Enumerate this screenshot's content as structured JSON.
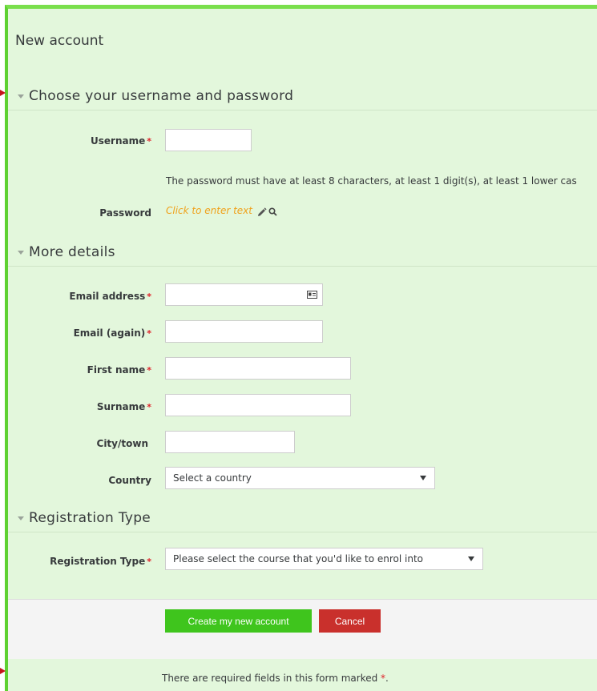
{
  "page": {
    "title": "New account"
  },
  "sections": {
    "credentials": {
      "title": "Choose your username and password"
    },
    "details": {
      "title": "More details"
    },
    "registration": {
      "title": "Registration Type"
    }
  },
  "fields": {
    "username": {
      "label": "Username",
      "value": ""
    },
    "password_hint": "The password must have at least 8 characters, at least 1 digit(s), at least 1 lower cas",
    "password": {
      "label": "Password",
      "link_text": "Click to enter text"
    },
    "email": {
      "label": "Email address",
      "value": ""
    },
    "email_again": {
      "label": "Email (again)",
      "value": ""
    },
    "first_name": {
      "label": "First name",
      "value": ""
    },
    "surname": {
      "label": "Surname",
      "value": ""
    },
    "city": {
      "label": "City/town",
      "value": ""
    },
    "country": {
      "label": "Country",
      "selected": "Select a country"
    },
    "registration_type": {
      "label": "Registration Type",
      "selected": "Please select the course that you'd like to enrol into"
    }
  },
  "required_marker": "*",
  "buttons": {
    "submit": "Create my new account",
    "cancel": "Cancel"
  },
  "footer": {
    "required_note": "There are required fields in this form marked",
    "required_marker": "*",
    "period": "."
  },
  "icons": {
    "chevron": "chevron-down-icon",
    "pencil": "pencil-icon",
    "search": "search-icon",
    "contact_card": "contact-card-icon",
    "pointer": "red-arrow-icon"
  },
  "colors": {
    "page_bg": "#e3f7dc",
    "border_green": "#5ed131",
    "primary_button": "#3fc51d",
    "cancel_button": "#c9302c",
    "required": "#e0232a",
    "link": "#f0a11a"
  }
}
